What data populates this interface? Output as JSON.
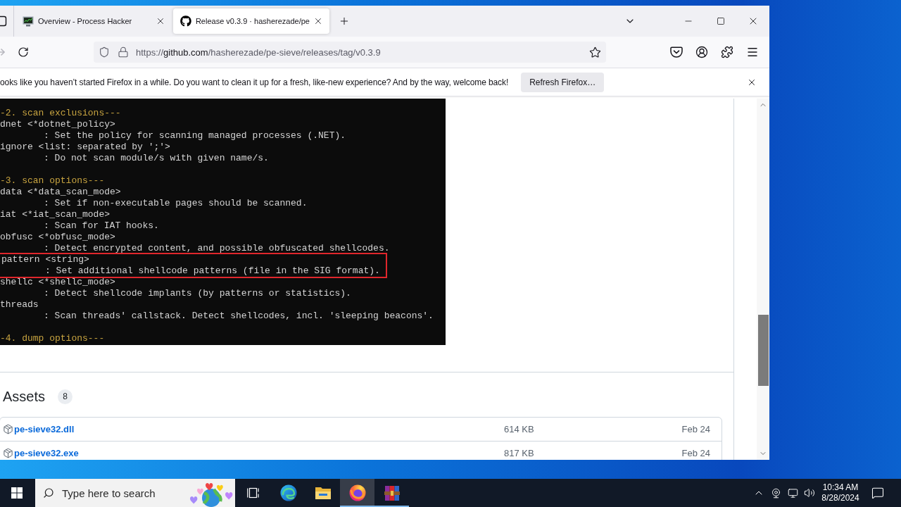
{
  "window": {
    "tabs": [
      {
        "kind": "process",
        "title": "Overview - Process Hacker",
        "selected": false
      },
      {
        "kind": "github",
        "title": "Release v0.3.9 · hasherezade/pe",
        "selected": true
      }
    ]
  },
  "address_bar": {
    "scheme": "https://",
    "host": "github.com",
    "path": "/hasherezade/pe-sieve/releases/tag/v0.3.9"
  },
  "notification": {
    "message": "ooks like you haven’t started Firefox in a while. Do you want to clean it up for a fresh, like-new experience? And by the way, welcome back!",
    "button": "Refresh Firefox…"
  },
  "terminal": {
    "lines": [
      {
        "kind": "heading",
        "text": "-2. scan exclusions---",
        "highlighted": false
      },
      {
        "kind": "option",
        "text": "dnet <*dotnet_policy>",
        "highlighted": false
      },
      {
        "kind": "description",
        "text": ": Set the policy for scanning managed processes (.NET).",
        "highlighted": false
      },
      {
        "kind": "option",
        "text": "ignore <list: separated by ';'>",
        "highlighted": false
      },
      {
        "kind": "description",
        "text": ": Do not scan module/s with given name/s.",
        "highlighted": false
      },
      {
        "kind": "blank"
      },
      {
        "kind": "heading",
        "text": "-3. scan options---",
        "highlighted": false
      },
      {
        "kind": "option",
        "text": "data <*data_scan_mode>",
        "highlighted": false
      },
      {
        "kind": "description",
        "text": ": Set if non-executable pages should be scanned.",
        "highlighted": false
      },
      {
        "kind": "option",
        "text": "iat <*iat_scan_mode>",
        "highlighted": false
      },
      {
        "kind": "description",
        "text": ": Scan for IAT hooks.",
        "highlighted": false
      },
      {
        "kind": "option",
        "text": "obfusc <*obfusc_mode>",
        "highlighted": false
      },
      {
        "kind": "description",
        "text": ": Detect encrypted content, and possible obfuscated shellcodes.",
        "highlighted": false
      },
      {
        "kind": "option",
        "text": "pattern <string>",
        "highlighted": true
      },
      {
        "kind": "description",
        "text": ": Set additional shellcode patterns (file in the SIG format).",
        "highlighted": true
      },
      {
        "kind": "option",
        "text": "shellc <*shellc_mode>",
        "highlighted": false
      },
      {
        "kind": "description",
        "text": ": Detect shellcode implants (by patterns or statistics).",
        "highlighted": false
      },
      {
        "kind": "option",
        "text": "threads",
        "highlighted": false
      },
      {
        "kind": "description",
        "text": ": Scan threads' callstack. Detect shellcodes, incl. 'sleeping beacons'.",
        "highlighted": false
      },
      {
        "kind": "blank"
      },
      {
        "kind": "heading",
        "text": "-4. dump options---",
        "highlighted": false
      }
    ]
  },
  "assets": {
    "title": "Assets",
    "count": "8",
    "files": [
      {
        "name": "pe-sieve32.dll",
        "size": "614 KB",
        "date": "Feb 24"
      },
      {
        "name": "pe-sieve32.exe",
        "size": "817 KB",
        "date": "Feb 24"
      }
    ]
  },
  "taskbar": {
    "search": {
      "placeholder": "Type here to search"
    },
    "apps": [
      {
        "kind": "task-view",
        "active": false,
        "running": false
      },
      {
        "kind": "edge",
        "active": false,
        "running": false
      },
      {
        "kind": "explorer",
        "active": false,
        "running": false
      },
      {
        "kind": "firefox",
        "active": true,
        "running": true
      },
      {
        "kind": "winrar",
        "active": false,
        "running": true
      }
    ],
    "clock": {
      "time": "10:34 AM",
      "date": "8/28/2024"
    }
  }
}
